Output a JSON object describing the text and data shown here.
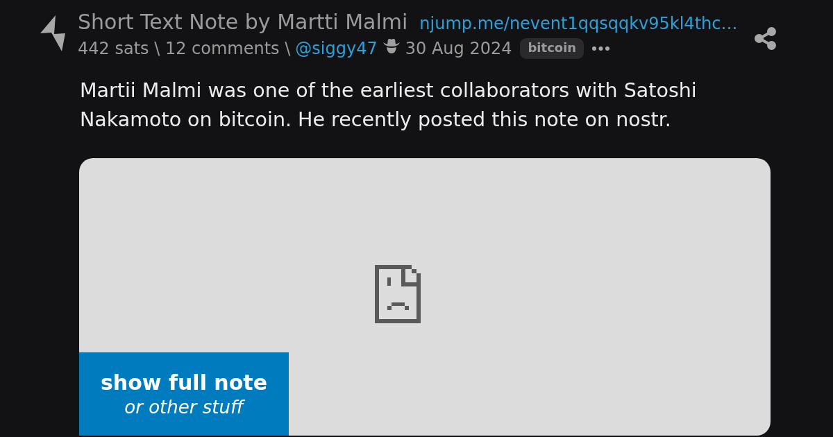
{
  "post": {
    "title": "Short Text Note by Martti Malmi",
    "link": "njump.me/nevent1qqsqqkv95kl4thc…",
    "stats": "442 sats \\ 12 comments \\",
    "author": "@siggy47",
    "date": "30 Aug 2024",
    "tag": "bitcoin",
    "body": "Martii Malmi was one of the earliest collaborators with Satoshi Nakamoto on bitcoin. He recently posted this note on nostr."
  },
  "embed": {
    "button_title": "show full note",
    "button_subtitle": "or other stuff"
  }
}
